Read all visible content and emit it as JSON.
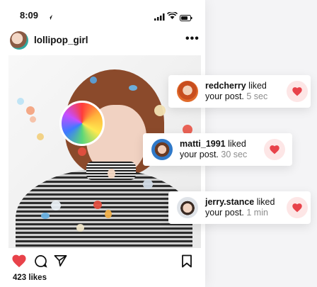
{
  "status_bar": {
    "time": "8:09"
  },
  "post": {
    "username": "lollipop_girl",
    "likes_text": "423 likes"
  },
  "notifications": [
    {
      "user": "redcherry",
      "action": "liked",
      "line2": "your post.",
      "time": "5 sec"
    },
    {
      "user": "matti_1991",
      "action": "liked",
      "line2": "your post.",
      "time": "30 sec"
    },
    {
      "user": "jerry.stance",
      "action": "liked",
      "line2": "your post.",
      "time": "1 min"
    }
  ],
  "colors": {
    "like_red": "#e8424a",
    "heart_bg": "#fde6e6",
    "muted_text": "#8c8c8c"
  },
  "icons": {
    "status": [
      "navigation-arrow-icon",
      "cellular-signal-icon",
      "wifi-icon",
      "battery-icon"
    ],
    "post_actions": [
      "heart-icon",
      "comment-icon",
      "share-icon",
      "bookmark-icon"
    ],
    "notification": "heart-icon"
  }
}
